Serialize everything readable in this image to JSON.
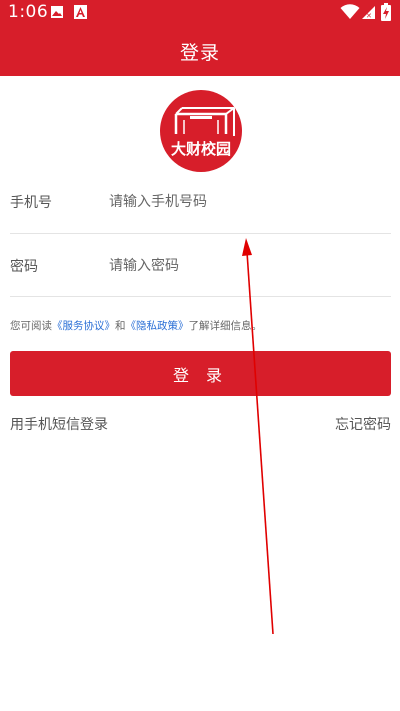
{
  "status_bar": {
    "time": "1:06",
    "icons": [
      "image-icon",
      "font-a-icon",
      "wifi-icon",
      "signal-icon",
      "battery-charging-icon"
    ]
  },
  "header": {
    "title": "登录"
  },
  "logo": {
    "text": "大财校园",
    "icon": "campus-gate-logo"
  },
  "form": {
    "phone_label": "手机号",
    "phone_placeholder": "请输入手机号码",
    "password_label": "密码",
    "password_placeholder": "请输入密码"
  },
  "agreement": {
    "prefix": "您可阅读",
    "service_link": "《服务协议》",
    "and": "和",
    "privacy_link": "《隐私政策》",
    "suffix": "了解详细信息。"
  },
  "login_button": "登 录",
  "sms_login": "用手机短信登录",
  "forgot_password": "忘记密码",
  "colors": {
    "brand": "#d71e2a",
    "link": "#2a6fd6",
    "annotation_arrow": "#e00000"
  }
}
